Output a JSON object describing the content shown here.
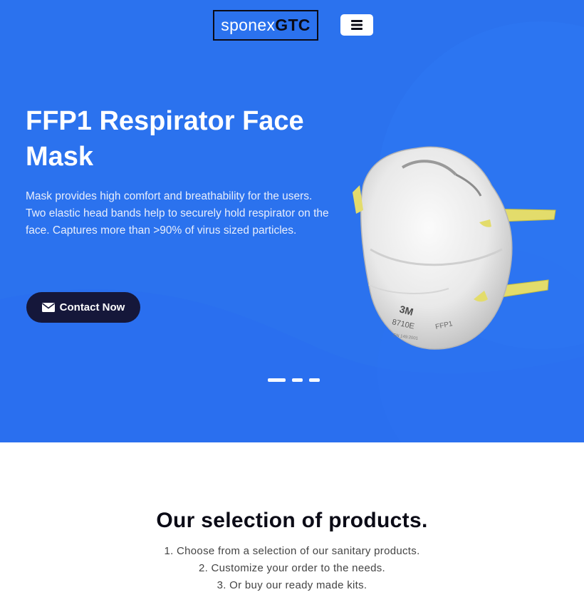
{
  "header": {
    "logo_part1": "sponex",
    "logo_part2": "GTC",
    "menu_icon": "hamburger-menu-icon"
  },
  "hero": {
    "title": "FFP1 Respirator Face Mask",
    "description": "Mask provides high comfort and breathability for the users. Two elastic head bands help to securely hold respirator on the face. Captures more than >90% of virus sized particles.",
    "cta_label": "Contact Now",
    "cta_icon": "envelope-icon",
    "image": "respirator-mask-image",
    "mask_brand": "3M",
    "mask_model": "8710E",
    "mask_rating": "FFP1",
    "mask_standard": "EN 149:2001",
    "slides": 3,
    "active_slide": 1,
    "colors": {
      "background": "#2b72ee",
      "button": "#15173a",
      "accent_strap": "#e3dc6b"
    }
  },
  "selection": {
    "title": "Our selection of products.",
    "items": [
      "1. Choose from a selection of our sanitary products.",
      "2. Customize your order to the needs.",
      "3. Or buy our ready made kits."
    ]
  }
}
